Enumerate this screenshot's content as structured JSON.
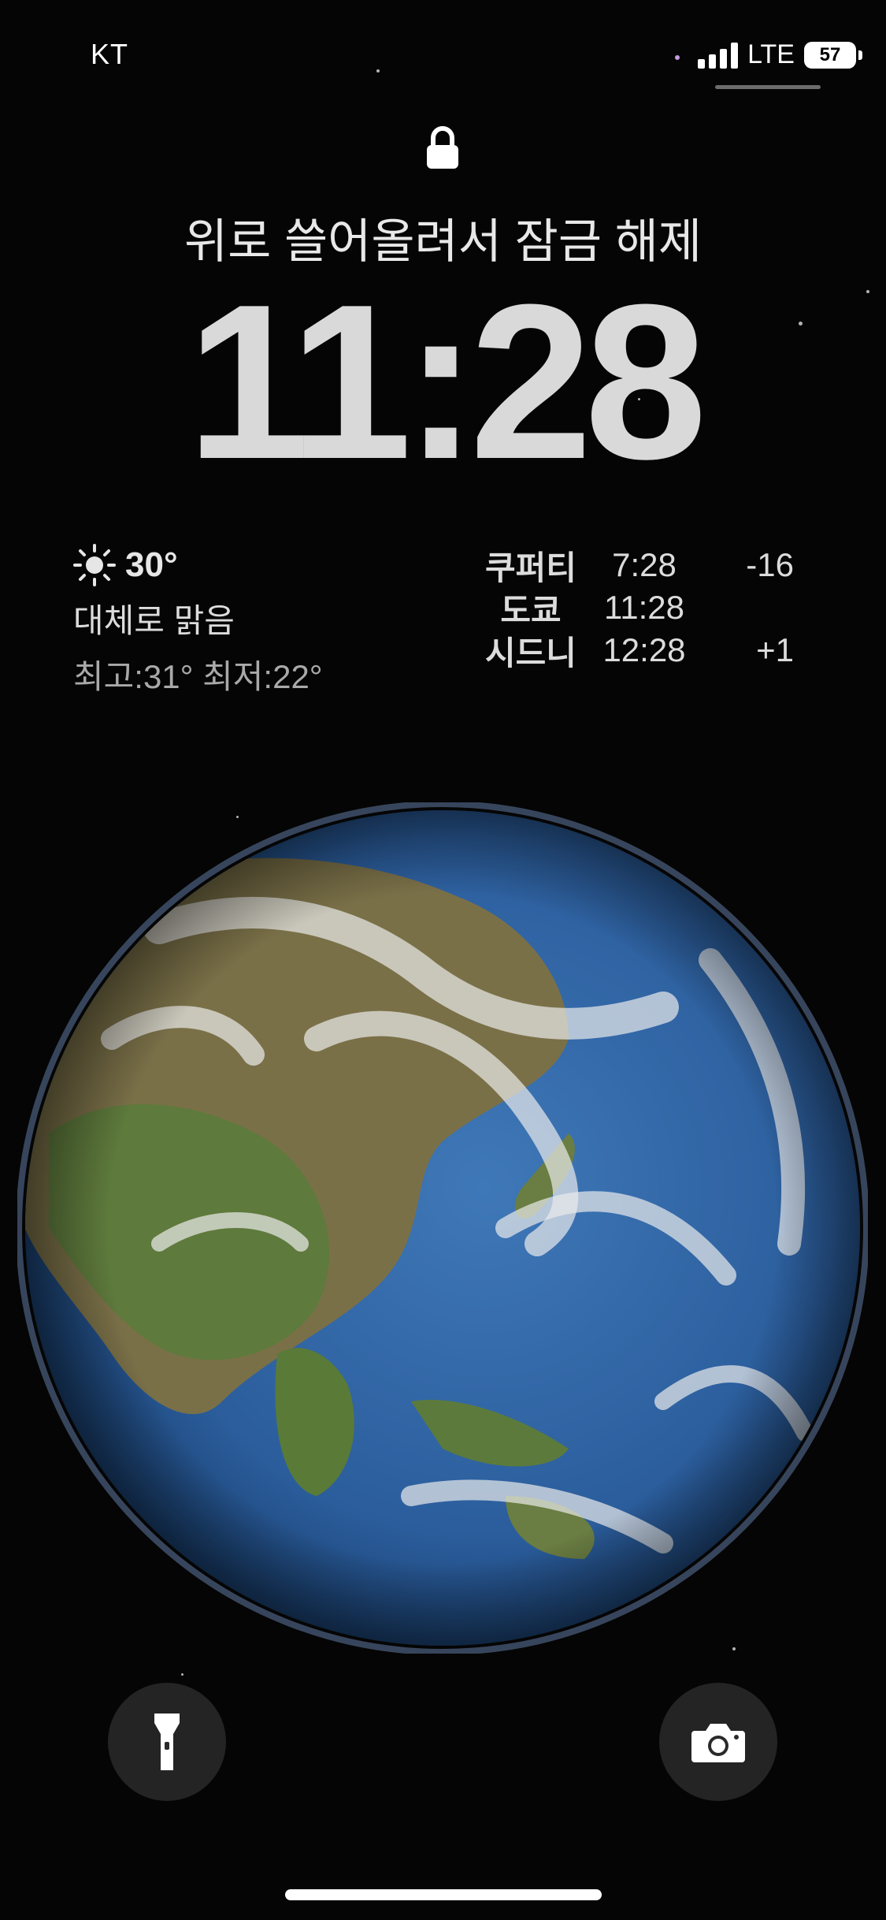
{
  "status_bar": {
    "carrier": "KT",
    "network": "LTE",
    "battery": "57"
  },
  "lock_screen": {
    "unlock_hint": "위로 쓸어올려서 잠금 해제",
    "time": "11:28"
  },
  "weather": {
    "icon": "sun-icon",
    "temperature": "30°",
    "condition": "대체로 맑음",
    "high_low": "최고:31° 최저:22°"
  },
  "world_clock": [
    {
      "city": "쿠퍼티",
      "time": "7:28",
      "diff": "-16"
    },
    {
      "city": "도쿄",
      "time": "11:28",
      "diff": ""
    },
    {
      "city": "시드니",
      "time": "12:28",
      "diff": "+1"
    }
  ],
  "buttons": {
    "flashlight": "flashlight-icon",
    "camera": "camera-icon"
  },
  "colors": {
    "background": "#050505",
    "text": "#ffffff"
  }
}
